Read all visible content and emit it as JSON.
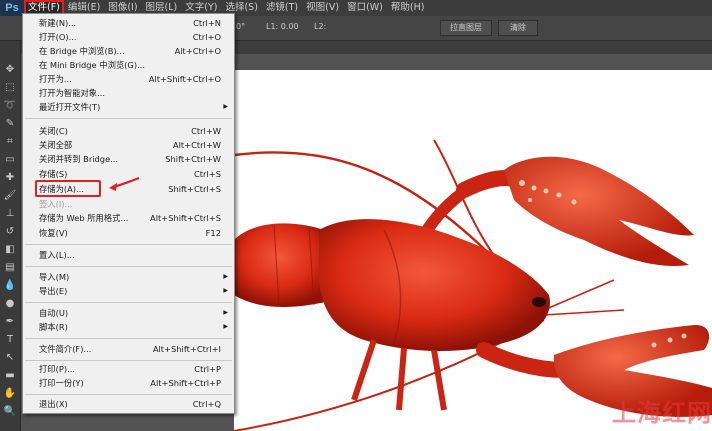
{
  "app": {
    "logo": "Ps"
  },
  "menubar": [
    {
      "label": "文件(F)",
      "active": true
    },
    {
      "label": "编辑(E)"
    },
    {
      "label": "图像(I)"
    },
    {
      "label": "图层(L)"
    },
    {
      "label": "文字(Y)"
    },
    {
      "label": "选择(S)"
    },
    {
      "label": "滤镜(T)"
    },
    {
      "label": "视图(V)"
    },
    {
      "label": "窗口(W)"
    },
    {
      "label": "帮助(H)"
    }
  ],
  "options_bar": {
    "angle_suffix": "0°",
    "l1": "L1: 0.00",
    "l2": "L2:",
    "straighten_button": "拉直图层",
    "clear_button": "清除"
  },
  "file_menu": {
    "items": [
      {
        "label": "新建(N)...",
        "shortcut": "Ctrl+N"
      },
      {
        "label": "打开(O)...",
        "shortcut": "Ctrl+O"
      },
      {
        "label": "在 Bridge 中浏览(B)...",
        "shortcut": "Alt+Ctrl+O"
      },
      {
        "label": "在 Mini Bridge 中浏览(G)...",
        "shortcut": ""
      },
      {
        "label": "打开为...",
        "shortcut": "Alt+Shift+Ctrl+O"
      },
      {
        "label": "打开为智能对象...",
        "shortcut": ""
      },
      {
        "label": "最近打开文件(T)",
        "shortcut": "",
        "submenu": true
      },
      {
        "label": "关闭(C)",
        "shortcut": "Ctrl+W"
      },
      {
        "label": "关闭全部",
        "shortcut": "Alt+Ctrl+W"
      },
      {
        "label": "关闭并转到 Bridge...",
        "shortcut": "Shift+Ctrl+W"
      },
      {
        "label": "存储(S)",
        "shortcut": "Ctrl+S"
      },
      {
        "label": "存储为(A)...",
        "shortcut": "Shift+Ctrl+S",
        "highlighted": true
      },
      {
        "label": "签入(I)...",
        "shortcut": "",
        "disabled": true
      },
      {
        "label": "存储为 Web 所用格式...",
        "shortcut": "Alt+Shift+Ctrl+S"
      },
      {
        "label": "恢复(V)",
        "shortcut": "F12"
      },
      {
        "label": "置入(L)...",
        "shortcut": ""
      },
      {
        "label": "导入(M)",
        "shortcut": "",
        "submenu": true
      },
      {
        "label": "导出(E)",
        "shortcut": "",
        "submenu": true
      },
      {
        "label": "自动(U)",
        "shortcut": "",
        "submenu": true
      },
      {
        "label": "脚本(R)",
        "shortcut": "",
        "submenu": true
      },
      {
        "label": "文件简介(F)...",
        "shortcut": "Alt+Shift+Ctrl+I"
      },
      {
        "label": "打印(P)...",
        "shortcut": "Ctrl+P"
      },
      {
        "label": "打印一份(Y)",
        "shortcut": "Alt+Shift+Ctrl+P"
      },
      {
        "label": "退出(X)",
        "shortcut": "Ctrl+Q"
      }
    ]
  },
  "canvas": {
    "subject": "red crayfish photo"
  },
  "watermark": "上海红网",
  "colors": {
    "highlight": "#e02020",
    "menu_bg": "#f0f0f0",
    "ui_dark": "#3c3c3c"
  }
}
